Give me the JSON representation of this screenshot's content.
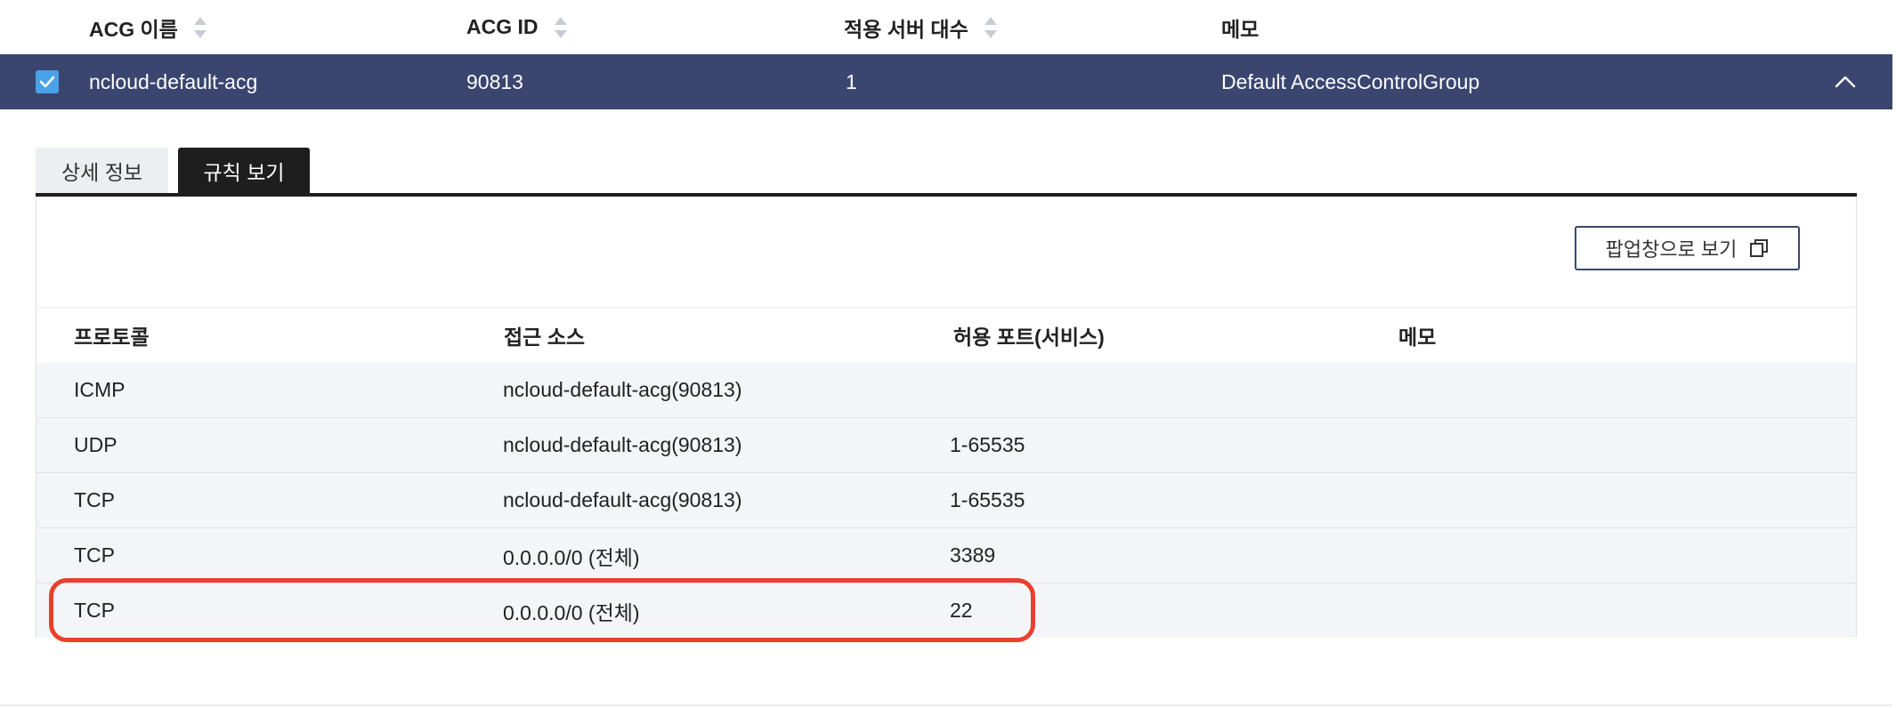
{
  "acg_table": {
    "columns": [
      "ACG 이름",
      "ACG ID",
      "적용 서버 대수",
      "메모"
    ],
    "selected_row": {
      "name": "ncloud-default-acg",
      "id": "90813",
      "server_count": "1",
      "memo": "Default AccessControlGroup",
      "checked": true
    }
  },
  "tabs": [
    {
      "label": "상세 정보",
      "active": false
    },
    {
      "label": "규칙 보기",
      "active": true
    }
  ],
  "rules_panel": {
    "popup_button_label": "팝업창으로 보기",
    "columns": [
      "프로토콜",
      "접근 소스",
      "허용 포트(서비스)",
      "메모"
    ],
    "rows": [
      {
        "protocol": "ICMP",
        "source": "ncloud-default-acg(90813)",
        "port": "",
        "memo": ""
      },
      {
        "protocol": "UDP",
        "source": "ncloud-default-acg(90813)",
        "port": "1-65535",
        "memo": ""
      },
      {
        "protocol": "TCP",
        "source": "ncloud-default-acg(90813)",
        "port": "1-65535",
        "memo": ""
      },
      {
        "protocol": "TCP",
        "source": "0.0.0.0/0 (전체)",
        "port": "3389",
        "memo": ""
      },
      {
        "protocol": "TCP",
        "source": "0.0.0.0/0 (전체)",
        "port": "22",
        "memo": ""
      }
    ],
    "highlighted_row": 4
  },
  "colors": {
    "selected_row_bg": "#3a4670",
    "checkbox": "#4aa3e8",
    "active_tab": "#1e1e1e",
    "highlight_border": "#e8402c",
    "rule_row_bg": "#f4f5f8"
  }
}
